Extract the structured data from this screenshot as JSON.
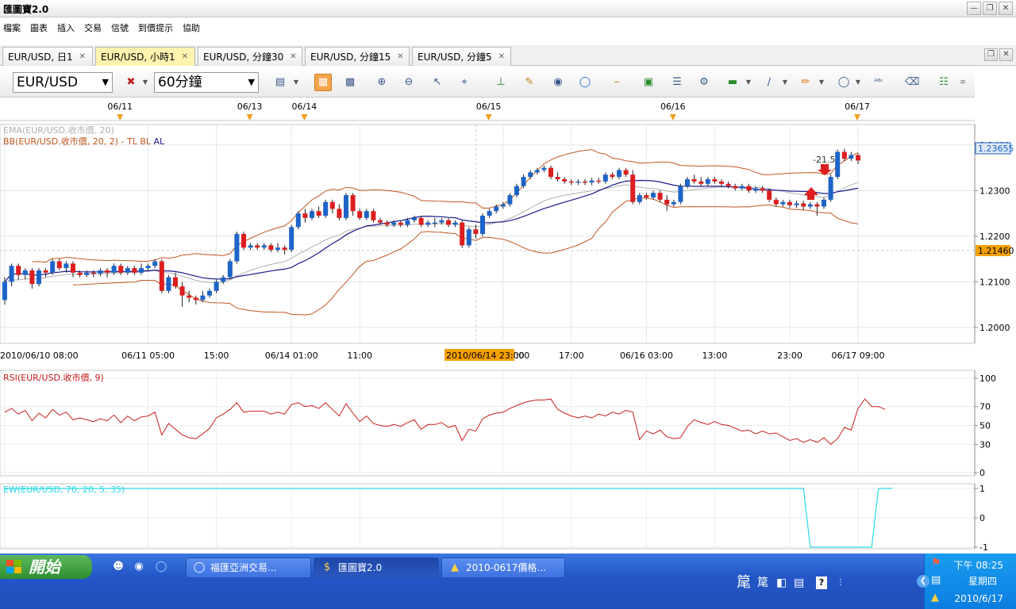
{
  "window": {
    "title": "匯圖寶2.0"
  },
  "menu": [
    "檔案",
    "圖表",
    "插入",
    "交易",
    "信號",
    "到價提示",
    "協助"
  ],
  "tabs": [
    {
      "label": "EUR/USD, 日1",
      "active": false
    },
    {
      "label": "EUR/USD, 小時1",
      "active": true
    },
    {
      "label": "EUR/USD, 分鐘30",
      "active": false
    },
    {
      "label": "EUR/USD, 分鐘15",
      "active": false
    },
    {
      "label": "EUR/USD, 分鐘5",
      "active": false
    }
  ],
  "toolbar": {
    "symbol": "EUR/USD",
    "period": "60分鐘",
    "icons": [
      "chart-type-icon",
      "bars-icon",
      "candles-icon",
      "zoom-in-icon",
      "zoom-out-icon",
      "cursor-icon",
      "crosshair-icon",
      "period-sep-icon",
      "edit-icon",
      "eye-icon",
      "globe-icon",
      "ruler-icon",
      "image-icon",
      "indicator-icon",
      "tools-icon",
      "line-icon",
      "trendline-icon",
      "pen-icon",
      "ellipse-icon",
      "text-icon",
      "eraser-icon",
      "objects-icon"
    ]
  },
  "chart": {
    "day_markers": [
      "06/11",
      "06/13",
      "06/14",
      "06/15",
      "06/16",
      "06/17"
    ],
    "legend_ema": "EMA(EUR/USD.收市價, 20)",
    "legend_bb": "BB(EUR/USD.收市價, 20, 2) - ",
    "legend_bb_tl": "TL",
    "legend_bb_bl": "BL",
    "legend_bb_al": "AL",
    "price_ticks": [
      "1.2400",
      "1.2300",
      "1.2200",
      "1.2100",
      "1.2000"
    ],
    "current_price": "1.23655",
    "cursor_price": "1.21460",
    "annotation": "-21.5",
    "time_labels": [
      "2010/06/10 08:00",
      "06/11 05:00",
      "15:00",
      "06/14 01:00",
      "11:00",
      "06/15 07:00",
      "17:00",
      "06/16 03:00",
      "13:00",
      "23:00",
      "06/17 09:00"
    ],
    "cursor_time": "2010/06/14 23:00",
    "rsi_legend": "RSI(EUR/USD.收市價, 9)",
    "rsi_ticks": [
      "100",
      "70",
      "50",
      "30",
      "0"
    ],
    "ew_legend": "EW(EUR/USD, 70, 20, 5, 35)",
    "ew_ticks": [
      "1",
      "0",
      "-1"
    ]
  },
  "colors": {
    "up": "#1e64c8",
    "down": "#dc1e1e",
    "ema": "#b0b0b0",
    "bb_band": "#c0561e",
    "bb_mid": "#1a1a8c",
    "rsi": "#c81e1e",
    "ew": "#2ad8e8",
    "cursor_label": "#f5a000"
  },
  "chart_data": {
    "type": "candlestick",
    "title": "",
    "xlabel": "",
    "ylabel": "",
    "ylim": [
      1.1965,
      1.2445
    ],
    "grid": true,
    "candles": [
      {
        "o": 1.206,
        "c": 1.21,
        "h": 1.211,
        "l": 1.205
      },
      {
        "o": 1.21,
        "c": 1.2135,
        "h": 1.214,
        "l": 1.209
      },
      {
        "o": 1.2135,
        "c": 1.2115,
        "h": 1.214,
        "l": 1.2105
      },
      {
        "o": 1.2115,
        "c": 1.2125,
        "h": 1.213,
        "l": 1.2105
      },
      {
        "o": 1.2125,
        "c": 1.2095,
        "h": 1.213,
        "l": 1.2085
      },
      {
        "o": 1.2095,
        "c": 1.2125,
        "h": 1.213,
        "l": 1.209
      },
      {
        "o": 1.2125,
        "c": 1.212,
        "h": 1.213,
        "l": 1.211
      },
      {
        "o": 1.212,
        "c": 1.2145,
        "h": 1.215,
        "l": 1.2115
      },
      {
        "o": 1.2145,
        "c": 1.213,
        "h": 1.215,
        "l": 1.2125
      },
      {
        "o": 1.213,
        "c": 1.214,
        "h": 1.2145,
        "l": 1.212
      },
      {
        "o": 1.214,
        "c": 1.212,
        "h": 1.2145,
        "l": 1.211
      },
      {
        "o": 1.212,
        "c": 1.2115,
        "h": 1.2125,
        "l": 1.211
      },
      {
        "o": 1.2115,
        "c": 1.212,
        "h": 1.2125,
        "l": 1.211
      },
      {
        "o": 1.212,
        "c": 1.2118,
        "h": 1.2125,
        "l": 1.211
      },
      {
        "o": 1.2118,
        "c": 1.2125,
        "h": 1.213,
        "l": 1.2112
      },
      {
        "o": 1.2125,
        "c": 1.212,
        "h": 1.213,
        "l": 1.211
      },
      {
        "o": 1.212,
        "c": 1.2135,
        "h": 1.214,
        "l": 1.2115
      },
      {
        "o": 1.2135,
        "c": 1.212,
        "h": 1.214,
        "l": 1.2115
      },
      {
        "o": 1.212,
        "c": 1.213,
        "h": 1.2135,
        "l": 1.2115
      },
      {
        "o": 1.213,
        "c": 1.212,
        "h": 1.2135,
        "l": 1.2115
      },
      {
        "o": 1.212,
        "c": 1.213,
        "h": 1.214,
        "l": 1.2115
      },
      {
        "o": 1.213,
        "c": 1.2135,
        "h": 1.214,
        "l": 1.2125
      },
      {
        "o": 1.2135,
        "c": 1.2145,
        "h": 1.215,
        "l": 1.213
      },
      {
        "o": 1.2145,
        "c": 1.208,
        "h": 1.215,
        "l": 1.2075
      },
      {
        "o": 1.208,
        "c": 1.211,
        "h": 1.2115,
        "l": 1.2075
      },
      {
        "o": 1.211,
        "c": 1.209,
        "h": 1.212,
        "l": 1.2085
      },
      {
        "o": 1.209,
        "c": 1.207,
        "h": 1.21,
        "l": 1.2045
      },
      {
        "o": 1.207,
        "c": 1.2065,
        "h": 1.208,
        "l": 1.2055
      },
      {
        "o": 1.2065,
        "c": 1.206,
        "h": 1.207,
        "l": 1.205
      },
      {
        "o": 1.206,
        "c": 1.207,
        "h": 1.208,
        "l": 1.2055
      },
      {
        "o": 1.207,
        "c": 1.208,
        "h": 1.2085,
        "l": 1.2065
      },
      {
        "o": 1.208,
        "c": 1.21,
        "h": 1.2105,
        "l": 1.2075
      },
      {
        "o": 1.21,
        "c": 1.211,
        "h": 1.2115,
        "l": 1.2095
      },
      {
        "o": 1.211,
        "c": 1.2145,
        "h": 1.215,
        "l": 1.2105
      },
      {
        "o": 1.2145,
        "c": 1.2205,
        "h": 1.221,
        "l": 1.214
      },
      {
        "o": 1.2205,
        "c": 1.2175,
        "h": 1.221,
        "l": 1.217
      },
      {
        "o": 1.2175,
        "c": 1.218,
        "h": 1.2185,
        "l": 1.217
      },
      {
        "o": 1.218,
        "c": 1.2175,
        "h": 1.2185,
        "l": 1.217
      },
      {
        "o": 1.2175,
        "c": 1.218,
        "h": 1.2185,
        "l": 1.217
      },
      {
        "o": 1.218,
        "c": 1.217,
        "h": 1.2185,
        "l": 1.2165
      },
      {
        "o": 1.217,
        "c": 1.2175,
        "h": 1.2185,
        "l": 1.2165
      },
      {
        "o": 1.2175,
        "c": 1.217,
        "h": 1.218,
        "l": 1.216
      },
      {
        "o": 1.217,
        "c": 1.222,
        "h": 1.2225,
        "l": 1.2165
      },
      {
        "o": 1.222,
        "c": 1.225,
        "h": 1.2255,
        "l": 1.2215
      },
      {
        "o": 1.225,
        "c": 1.224,
        "h": 1.226,
        "l": 1.223
      },
      {
        "o": 1.224,
        "c": 1.2255,
        "h": 1.226,
        "l": 1.2235
      },
      {
        "o": 1.2255,
        "c": 1.2245,
        "h": 1.2265,
        "l": 1.224
      },
      {
        "o": 1.2245,
        "c": 1.2275,
        "h": 1.228,
        "l": 1.224
      },
      {
        "o": 1.2275,
        "c": 1.226,
        "h": 1.228,
        "l": 1.225
      },
      {
        "o": 1.226,
        "c": 1.224,
        "h": 1.227,
        "l": 1.2235
      },
      {
        "o": 1.224,
        "c": 1.229,
        "h": 1.2295,
        "l": 1.2235
      },
      {
        "o": 1.229,
        "c": 1.2255,
        "h": 1.2295,
        "l": 1.2245
      },
      {
        "o": 1.2255,
        "c": 1.224,
        "h": 1.226,
        "l": 1.2235
      },
      {
        "o": 1.224,
        "c": 1.2255,
        "h": 1.226,
        "l": 1.2235
      },
      {
        "o": 1.2255,
        "c": 1.2235,
        "h": 1.226,
        "l": 1.223
      },
      {
        "o": 1.2235,
        "c": 1.223,
        "h": 1.224,
        "l": 1.2225
      },
      {
        "o": 1.223,
        "c": 1.2225,
        "h": 1.2235,
        "l": 1.222
      },
      {
        "o": 1.2225,
        "c": 1.223,
        "h": 1.2235,
        "l": 1.222
      },
      {
        "o": 1.223,
        "c": 1.2225,
        "h": 1.2235,
        "l": 1.222
      },
      {
        "o": 1.2225,
        "c": 1.2235,
        "h": 1.224,
        "l": 1.222
      },
      {
        "o": 1.2235,
        "c": 1.224,
        "h": 1.2245,
        "l": 1.223
      },
      {
        "o": 1.224,
        "c": 1.2225,
        "h": 1.2245,
        "l": 1.222
      },
      {
        "o": 1.2225,
        "c": 1.223,
        "h": 1.2235,
        "l": 1.222
      },
      {
        "o": 1.223,
        "c": 1.223,
        "h": 1.224,
        "l": 1.222
      },
      {
        "o": 1.223,
        "c": 1.2235,
        "h": 1.224,
        "l": 1.2225
      },
      {
        "o": 1.2235,
        "c": 1.2225,
        "h": 1.224,
        "l": 1.222
      },
      {
        "o": 1.2225,
        "c": 1.223,
        "h": 1.2235,
        "l": 1.222
      },
      {
        "o": 1.223,
        "c": 1.218,
        "h": 1.2235,
        "l": 1.2175
      },
      {
        "o": 1.218,
        "c": 1.2215,
        "h": 1.222,
        "l": 1.2175
      },
      {
        "o": 1.2215,
        "c": 1.2205,
        "h": 1.2225,
        "l": 1.2195
      },
      {
        "o": 1.2205,
        "c": 1.2245,
        "h": 1.225,
        "l": 1.22
      },
      {
        "o": 1.2245,
        "c": 1.2255,
        "h": 1.226,
        "l": 1.224
      },
      {
        "o": 1.2255,
        "c": 1.2265,
        "h": 1.227,
        "l": 1.225
      },
      {
        "o": 1.2265,
        "c": 1.227,
        "h": 1.2275,
        "l": 1.226
      },
      {
        "o": 1.227,
        "c": 1.229,
        "h": 1.2295,
        "l": 1.2265
      },
      {
        "o": 1.229,
        "c": 1.231,
        "h": 1.2315,
        "l": 1.2285
      },
      {
        "o": 1.231,
        "c": 1.233,
        "h": 1.2335,
        "l": 1.2305
      },
      {
        "o": 1.233,
        "c": 1.234,
        "h": 1.2345,
        "l": 1.2325
      },
      {
        "o": 1.234,
        "c": 1.2345,
        "h": 1.235,
        "l": 1.2335
      },
      {
        "o": 1.2345,
        "c": 1.235,
        "h": 1.2355,
        "l": 1.234
      },
      {
        "o": 1.235,
        "c": 1.233,
        "h": 1.2355,
        "l": 1.2325
      },
      {
        "o": 1.233,
        "c": 1.2325,
        "h": 1.234,
        "l": 1.232
      },
      {
        "o": 1.2325,
        "c": 1.232,
        "h": 1.233,
        "l": 1.2315
      },
      {
        "o": 1.232,
        "c": 1.2318,
        "h": 1.2325,
        "l": 1.2312
      },
      {
        "o": 1.2318,
        "c": 1.232,
        "h": 1.2325,
        "l": 1.2312
      },
      {
        "o": 1.232,
        "c": 1.2318,
        "h": 1.2325,
        "l": 1.2312
      },
      {
        "o": 1.2318,
        "c": 1.2322,
        "h": 1.2328,
        "l": 1.2312
      },
      {
        "o": 1.2322,
        "c": 1.232,
        "h": 1.2328,
        "l": 1.2315
      },
      {
        "o": 1.232,
        "c": 1.2335,
        "h": 1.234,
        "l": 1.2315
      },
      {
        "o": 1.2335,
        "c": 1.233,
        "h": 1.234,
        "l": 1.2325
      },
      {
        "o": 1.233,
        "c": 1.2345,
        "h": 1.235,
        "l": 1.2325
      },
      {
        "o": 1.2345,
        "c": 1.2335,
        "h": 1.235,
        "l": 1.233
      },
      {
        "o": 1.2335,
        "c": 1.2275,
        "h": 1.2345,
        "l": 1.227
      },
      {
        "o": 1.2275,
        "c": 1.229,
        "h": 1.2295,
        "l": 1.227
      },
      {
        "o": 1.229,
        "c": 1.2285,
        "h": 1.2295,
        "l": 1.228
      },
      {
        "o": 1.2285,
        "c": 1.2295,
        "h": 1.23,
        "l": 1.228
      },
      {
        "o": 1.2295,
        "c": 1.228,
        "h": 1.23,
        "l": 1.2275
      },
      {
        "o": 1.228,
        "c": 1.227,
        "h": 1.229,
        "l": 1.2255
      },
      {
        "o": 1.227,
        "c": 1.2275,
        "h": 1.228,
        "l": 1.2265
      },
      {
        "o": 1.2275,
        "c": 1.231,
        "h": 1.2315,
        "l": 1.227
      },
      {
        "o": 1.231,
        "c": 1.2325,
        "h": 1.233,
        "l": 1.2305
      },
      {
        "o": 1.2325,
        "c": 1.232,
        "h": 1.2335,
        "l": 1.2315
      },
      {
        "o": 1.232,
        "c": 1.2315,
        "h": 1.233,
        "l": 1.231
      },
      {
        "o": 1.2315,
        "c": 1.2325,
        "h": 1.233,
        "l": 1.231
      },
      {
        "o": 1.2325,
        "c": 1.232,
        "h": 1.233,
        "l": 1.2315
      },
      {
        "o": 1.232,
        "c": 1.2315,
        "h": 1.2325,
        "l": 1.231
      },
      {
        "o": 1.2315,
        "c": 1.231,
        "h": 1.232,
        "l": 1.2305
      },
      {
        "o": 1.231,
        "c": 1.2305,
        "h": 1.2315,
        "l": 1.23
      },
      {
        "o": 1.2305,
        "c": 1.231,
        "h": 1.2315,
        "l": 1.23
      },
      {
        "o": 1.231,
        "c": 1.23,
        "h": 1.2315,
        "l": 1.2295
      },
      {
        "o": 1.23,
        "c": 1.2305,
        "h": 1.231,
        "l": 1.2295
      },
      {
        "o": 1.2305,
        "c": 1.23,
        "h": 1.231,
        "l": 1.2295
      },
      {
        "o": 1.23,
        "c": 1.228,
        "h": 1.2305,
        "l": 1.2275
      },
      {
        "o": 1.228,
        "c": 1.227,
        "h": 1.2285,
        "l": 1.2265
      },
      {
        "o": 1.227,
        "c": 1.2275,
        "h": 1.228,
        "l": 1.2265
      },
      {
        "o": 1.2275,
        "c": 1.2268,
        "h": 1.228,
        "l": 1.2262
      },
      {
        "o": 1.2268,
        "c": 1.2272,
        "h": 1.2278,
        "l": 1.2262
      },
      {
        "o": 1.2272,
        "c": 1.2265,
        "h": 1.2278,
        "l": 1.2258
      },
      {
        "o": 1.2265,
        "c": 1.227,
        "h": 1.2275,
        "l": 1.226
      },
      {
        "o": 1.227,
        "c": 1.2265,
        "h": 1.2275,
        "l": 1.2245
      },
      {
        "o": 1.2265,
        "c": 1.228,
        "h": 1.2285,
        "l": 1.226
      },
      {
        "o": 1.228,
        "c": 1.233,
        "h": 1.2335,
        "l": 1.2275
      },
      {
        "o": 1.233,
        "c": 1.2385,
        "h": 1.239,
        "l": 1.2325
      },
      {
        "o": 1.2385,
        "c": 1.237,
        "h": 1.2392,
        "l": 1.2365
      },
      {
        "o": 1.237,
        "c": 1.2378,
        "h": 1.2385,
        "l": 1.2365
      },
      {
        "o": 1.2378,
        "c": 1.2366,
        "h": 1.2382,
        "l": 1.2358
      }
    ],
    "rsi_values": [
      64,
      68,
      62,
      66,
      55,
      63,
      58,
      67,
      61,
      64,
      56,
      58,
      56,
      54,
      57,
      55,
      61,
      53,
      60,
      55,
      59,
      60,
      64,
      40,
      52,
      46,
      40,
      37,
      36,
      41,
      47,
      58,
      62,
      67,
      74,
      64,
      65,
      65,
      65,
      62,
      64,
      62,
      72,
      74,
      70,
      71,
      68,
      74,
      67,
      60,
      73,
      63,
      54,
      60,
      52,
      50,
      49,
      51,
      49,
      53,
      56,
      46,
      51,
      51,
      53,
      48,
      50,
      34,
      46,
      44,
      57,
      61,
      63,
      64,
      68,
      71,
      74,
      76,
      77,
      77,
      78,
      67,
      63,
      60,
      58,
      60,
      58,
      62,
      60,
      64,
      62,
      66,
      64,
      35,
      44,
      41,
      45,
      38,
      36,
      37,
      49,
      56,
      53,
      51,
      54,
      51,
      50,
      47,
      44,
      45,
      41,
      44,
      41,
      42,
      38,
      34,
      36,
      32,
      35,
      32,
      37,
      30,
      36,
      48,
      45,
      68,
      78,
      70,
      70,
      67
    ],
    "ew_values": [
      1,
      1,
      1,
      1,
      1,
      1,
      1,
      1,
      1,
      1,
      1,
      1,
      1,
      1,
      1,
      1,
      1,
      1,
      1,
      1,
      1,
      1,
      1,
      1,
      1,
      1,
      1,
      1,
      1,
      1,
      1,
      1,
      1,
      1,
      1,
      1,
      1,
      1,
      1,
      1,
      1,
      1,
      1,
      1,
      1,
      1,
      1,
      1,
      1,
      1,
      1,
      1,
      1,
      1,
      1,
      1,
      1,
      1,
      1,
      1,
      1,
      1,
      1,
      1,
      1,
      1,
      1,
      1,
      1,
      1,
      1,
      1,
      1,
      1,
      1,
      1,
      1,
      1,
      1,
      1,
      1,
      1,
      1,
      1,
      1,
      1,
      1,
      1,
      1,
      1,
      1,
      1,
      1,
      1,
      1,
      1,
      1,
      1,
      1,
      1,
      1,
      1,
      1,
      1,
      1,
      1,
      1,
      1,
      1,
      1,
      1,
      1,
      1,
      1,
      1,
      1,
      1,
      1,
      -1,
      -1,
      -1,
      -1,
      -1,
      -1,
      -1,
      -1,
      -1,
      -1,
      1,
      1,
      1
    ]
  },
  "taskbar": {
    "start": "開始",
    "items": [
      {
        "label": "福匯亞洲交易...",
        "active": false
      },
      {
        "label": "匯圖寶2.0",
        "active": true
      },
      {
        "label": "2010-0617價格...",
        "active": false
      }
    ],
    "ime1": "䇻",
    "ime2": "䇻",
    "clock_time": "下午 08:25",
    "clock_day": "星期四",
    "clock_date": "2010/6/17"
  }
}
